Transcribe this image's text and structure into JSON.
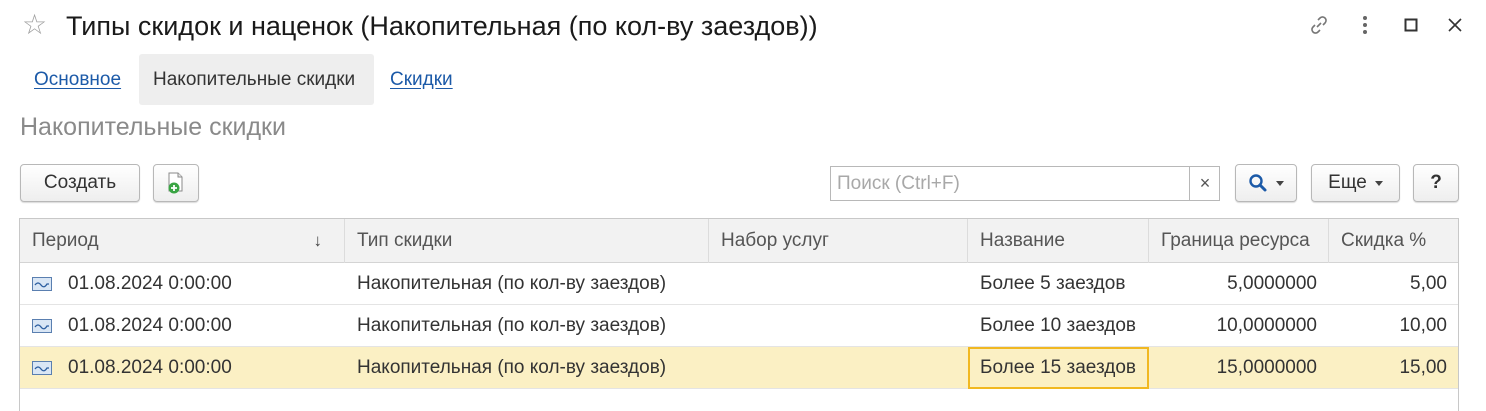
{
  "window": {
    "title": "Типы скидок и наценок (Накопительная (по кол-ву заездов))",
    "icons": [
      "star-icon",
      "link-icon",
      "more-vertical-icon",
      "maximize-icon",
      "close-icon"
    ]
  },
  "tabs": [
    {
      "label": "Основное",
      "active": false
    },
    {
      "label": "Накопительные скидки",
      "active": true
    },
    {
      "label": "Скидки",
      "active": false
    }
  ],
  "section": {
    "title": "Накопительные скидки"
  },
  "toolbar": {
    "create_label": "Создать",
    "search_placeholder": "Поиск (Ctrl+F)",
    "search_value": "",
    "clear_label": "×",
    "more_label": "Еще",
    "help_label": "?"
  },
  "table": {
    "columns": [
      "Период",
      "Тип скидки",
      "Набор услуг",
      "Название",
      "Граница ресурса",
      "Скидка %"
    ],
    "sort_indicator": "↓",
    "rows": [
      {
        "period": "01.08.2024 0:00:00",
        "type": "Накопительная (по кол-ву заездов)",
        "services": "",
        "name": "Более 5 заездов",
        "limit": "5,0000000",
        "discount": "5,00",
        "selected": false
      },
      {
        "period": "01.08.2024 0:00:00",
        "type": "Накопительная (по кол-ву заездов)",
        "services": "",
        "name": "Более 10 заездов",
        "limit": "10,0000000",
        "discount": "10,00",
        "selected": false
      },
      {
        "period": "01.08.2024 0:00:00",
        "type": "Накопительная (по кол-ву заездов)",
        "services": "",
        "name": "Более 15 заездов",
        "limit": "15,0000000",
        "discount": "15,00",
        "selected": true
      }
    ]
  },
  "colors": {
    "accent_link": "#1c5aa8",
    "selected_row": "#fbf0c4",
    "cell_cursor": "#f1b821"
  }
}
